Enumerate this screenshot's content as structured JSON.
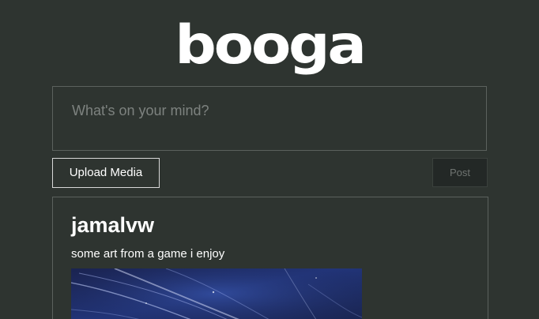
{
  "app": {
    "logo_text": "booga"
  },
  "composer": {
    "placeholder": "What's on your mind?",
    "value": ""
  },
  "actions": {
    "upload_label": "Upload Media",
    "post_label": "Post"
  },
  "feed": {
    "posts": [
      {
        "author": "jamalvw",
        "text": "some art from a game i enjoy",
        "media_icon": "image-thumbnail"
      }
    ]
  },
  "colors": {
    "background": "#2e3430",
    "border": "#5b615d",
    "text": "#ffffff",
    "placeholder": "#7d827f",
    "post_button_bg": "#232826",
    "media_blue": "#1f2f63"
  }
}
